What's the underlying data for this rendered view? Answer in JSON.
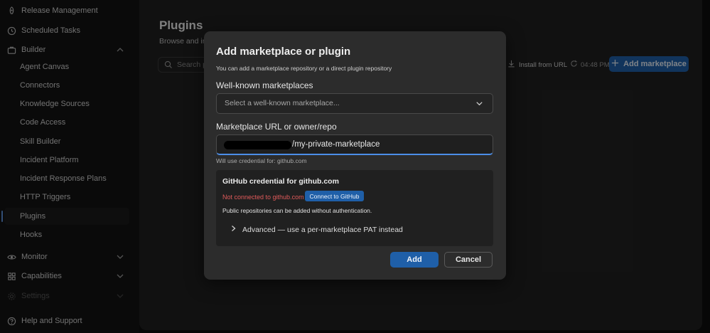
{
  "sidebar": {
    "release_management": "Release Management",
    "scheduled_tasks": "Scheduled Tasks",
    "builder": "Builder",
    "builder_items": [
      "Agent Canvas",
      "Connectors",
      "Knowledge Sources",
      "Code Access",
      "Skill Builder",
      "Incident Platform",
      "Incident Response Plans",
      "HTTP Triggers",
      "Plugins",
      "Hooks"
    ],
    "monitor": "Monitor",
    "capabilities": "Capabilities",
    "settings": "Settings",
    "help": "Help and Support",
    "active_item": "Plugins"
  },
  "main": {
    "title": "Plugins",
    "subtitle": "Browse and ins",
    "search_placeholder": "Search p",
    "install_from_url": "Install from URL",
    "last_refresh": "04:48 PM",
    "add_marketplace": "Add marketplace"
  },
  "modal": {
    "title": "Add marketplace or plugin",
    "subtitle": "You can add a marketplace repository or a direct plugin repository",
    "well_known_label": "Well-known marketplaces",
    "well_known_placeholder": "Select a well-known marketplace...",
    "url_label": "Marketplace URL or owner/repo",
    "url_value_visible": "/my-private-marketplace",
    "credential_hint": "Will use credential for: github.com",
    "credential": {
      "title": "GitHub credential for github.com",
      "status": "Not connected to github.com",
      "connect_label": "Connect to GitHub",
      "public_note": "Public repositories can be added without authentication.",
      "advanced_label": "Advanced — use a per-marketplace PAT instead"
    },
    "add_label": "Add",
    "cancel_label": "Cancel"
  },
  "colors": {
    "accent": "#1f5fa8",
    "error": "#e05a5a",
    "focus": "#4c8ee8"
  }
}
